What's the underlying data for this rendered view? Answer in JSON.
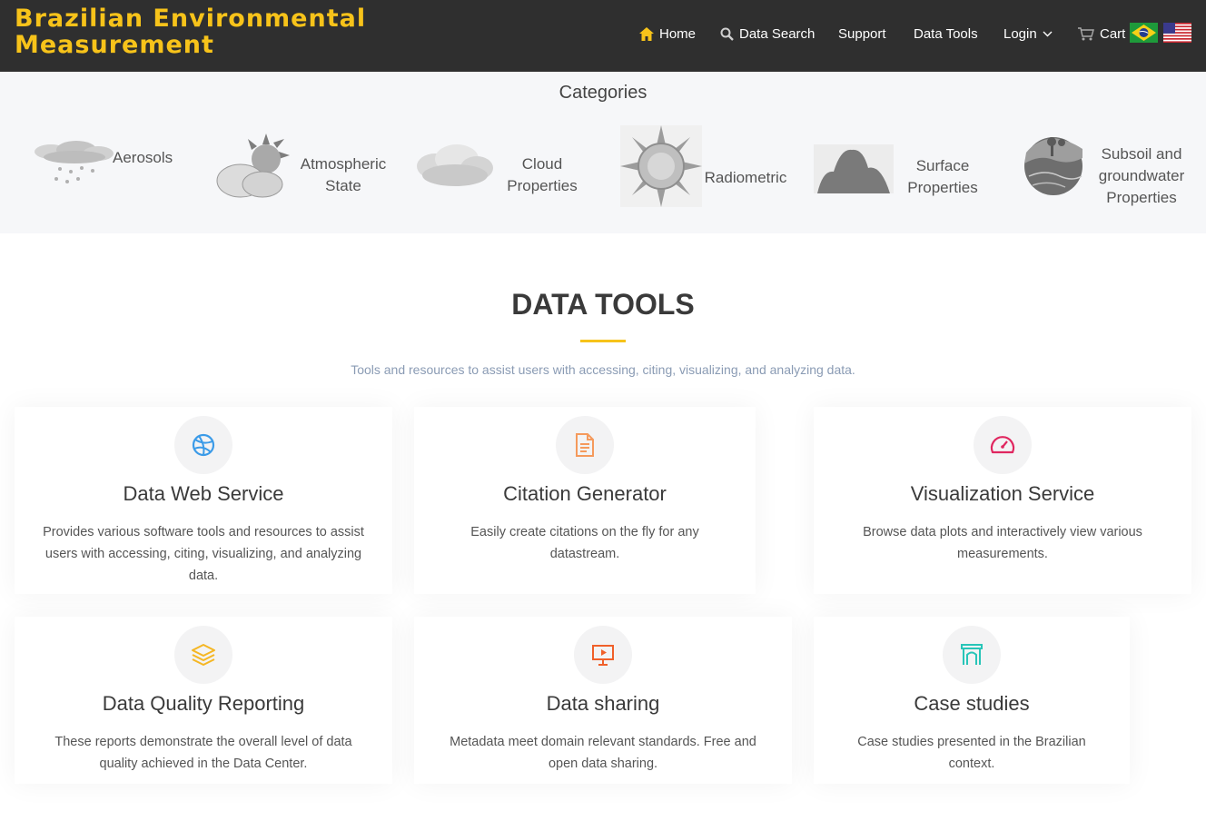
{
  "brand": {
    "line1": "Brazilian Environmental",
    "line2": "Measurement"
  },
  "nav": {
    "home": "Home",
    "data_search": "Data Search",
    "support": "Support",
    "data_tools": "Data Tools",
    "login": "Login",
    "cart": "Cart"
  },
  "categories": {
    "title": "Categories",
    "items": [
      {
        "label": "Aerosols",
        "icon": "aerosols-icon"
      },
      {
        "label": "Atmospheric State",
        "icon": "atmospheric-icon"
      },
      {
        "label": "Cloud Properties",
        "icon": "cloud-icon"
      },
      {
        "label": "Radiometric",
        "icon": "sun-icon"
      },
      {
        "label": "Surface Properties",
        "icon": "mountains-icon"
      },
      {
        "label": "Subsoil and groundwater Properties",
        "icon": "subsoil-icon"
      }
    ]
  },
  "tools": {
    "title": "DATA TOOLS",
    "subtitle": "Tools and resources to assist users with accessing, citing, visualizing, and analyzing data.",
    "cards": [
      {
        "title": "Data Web Service",
        "desc": "Provides various software tools and resources to assist users with accessing, citing, visualizing, and analyzing data.",
        "icon": "globe-icon",
        "color": "#3b9be8"
      },
      {
        "title": "Citation Generator",
        "desc": "Easily create citations on the fly for any datastream.",
        "icon": "document-icon",
        "color": "#f59a5c"
      },
      {
        "title": "Visualization Service",
        "desc": "Browse data plots and interactively view various measurements.",
        "icon": "speedometer-icon",
        "color": "#e0265f"
      },
      {
        "title": "Data Quality Reporting",
        "desc": "These reports demonstrate the overall level of data quality achieved in the Data Center.",
        "icon": "layers-icon",
        "color": "#f5b623"
      },
      {
        "title": "Data sharing",
        "desc": "Metadata meet domain relevant standards. Free and open data sharing.",
        "icon": "presentation-icon",
        "color": "#f0602a"
      },
      {
        "title": "Case studies",
        "desc": "Case studies presented in the Brazilian context.",
        "icon": "archway-icon",
        "color": "#27c5b8"
      }
    ]
  }
}
